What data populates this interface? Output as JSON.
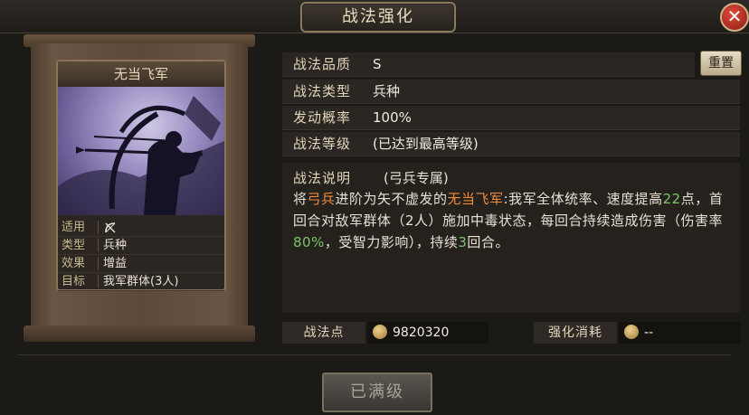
{
  "window": {
    "title": "战法强化",
    "close_label": "✕"
  },
  "card": {
    "name": "无当飞军",
    "stats": [
      {
        "key": "适用",
        "value": "",
        "icon": "bow-icon"
      },
      {
        "key": "类型",
        "value": "兵种"
      },
      {
        "key": "效果",
        "value": "增益"
      },
      {
        "key": "目标",
        "value": "我军群体(3人)"
      }
    ]
  },
  "info": {
    "quality": {
      "label": "战法品质",
      "value": "S"
    },
    "type": {
      "label": "战法类型",
      "value": "兵种"
    },
    "chance": {
      "label": "发动概率",
      "value": "100%"
    },
    "level": {
      "label": "战法等级",
      "value": "(已达到最高等级)"
    },
    "reset_label": "重置"
  },
  "description": {
    "title": "战法说明",
    "tag": "(弓兵专属)",
    "parts": [
      "将",
      "弓兵",
      "进阶为矢不虚发的",
      "无当飞军",
      ":我军全体统率、速度提高",
      "22",
      "点，首回合对敌军群体（2人）施加中毒状态，每回合持续造成伤害（伤害率",
      "80%",
      "，受智力影响），持续",
      "3",
      "回合。"
    ]
  },
  "footer": {
    "points_label": "战法点",
    "points_value": "9820320",
    "cost_label": "强化消耗",
    "cost_value": "--",
    "maxed_label": "已满级"
  },
  "colors": {
    "highlight_orange": "#f08a3c",
    "highlight_green": "#7cc46a"
  }
}
